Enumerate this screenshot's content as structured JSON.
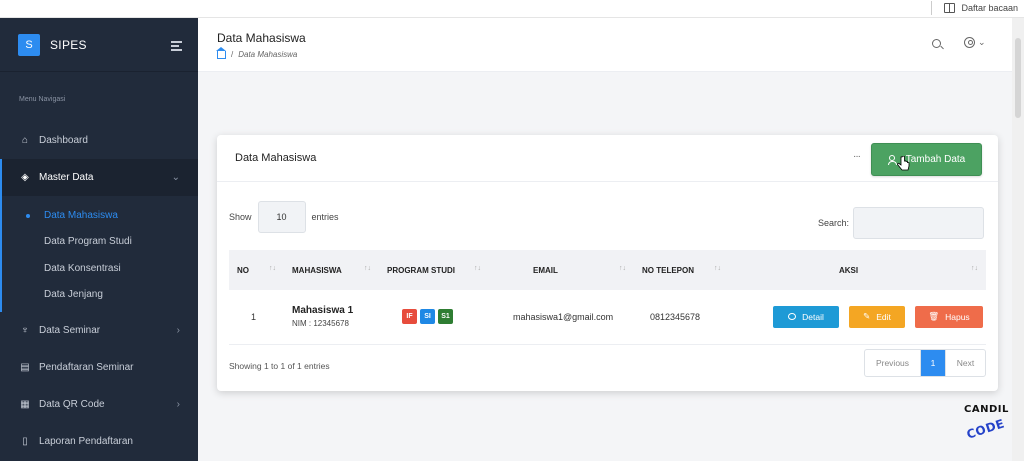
{
  "browser": {
    "reading_list": "Daftar bacaan"
  },
  "sidebar": {
    "brand_logo": "S",
    "brand_name": "SIPES",
    "nav_title": "Menu Navigasi",
    "items": [
      {
        "label": "Dashboard",
        "icon": "home-icon"
      },
      {
        "label": "Master Data",
        "icon": "layers-icon"
      },
      {
        "label": "Data Seminar",
        "icon": "microphone-icon"
      },
      {
        "label": "Pendaftaran Seminar",
        "icon": "document-icon"
      },
      {
        "label": "Data QR Code",
        "icon": "qr-code-icon"
      },
      {
        "label": "Laporan Pendaftaran",
        "icon": "report-icon"
      }
    ],
    "sub_items": [
      {
        "label": "Data Mahasiswa"
      },
      {
        "label": "Data Program Studi"
      },
      {
        "label": "Data Konsentrasi"
      },
      {
        "label": "Data Jenjang"
      }
    ]
  },
  "header": {
    "title": "Data Mahasiswa",
    "breadcrumb": "Data Mahasiswa"
  },
  "card": {
    "title": "Data Mahasiswa",
    "more": "···",
    "add_button": "Tambah Data"
  },
  "table_controls": {
    "show_label": "Show",
    "length_value": "10",
    "entries_label": "entries",
    "search_label": "Search:"
  },
  "table": {
    "columns": [
      "NO",
      "MAHASISWA",
      "PROGRAM STUDI",
      "EMAIL",
      "NO TELEPON",
      "AKSI"
    ],
    "rows": [
      {
        "no": "1",
        "name": "Mahasiswa 1",
        "nim": "NIM : 12345678",
        "prodi": [
          "IF",
          "SI",
          "S1"
        ],
        "email": "mahasiswa1@gmail.com",
        "telp": "0812345678",
        "actions": {
          "detail": "Detail",
          "edit": "Edit",
          "hapus": "Hapus"
        }
      }
    ]
  },
  "footer": {
    "info": "Showing 1 to 1 of 1 entries",
    "prev": "Previous",
    "page": "1",
    "next": "Next"
  },
  "watermark": {
    "line1": "CANDIL",
    "line2": "CODE"
  },
  "colors": {
    "sidebar_bg": "#212b3b",
    "accent": "#2d8cf0",
    "add_button": "#4ca262",
    "detail": "#1e9ad6",
    "edit": "#f4a623",
    "hapus": "#ef6c4a"
  }
}
